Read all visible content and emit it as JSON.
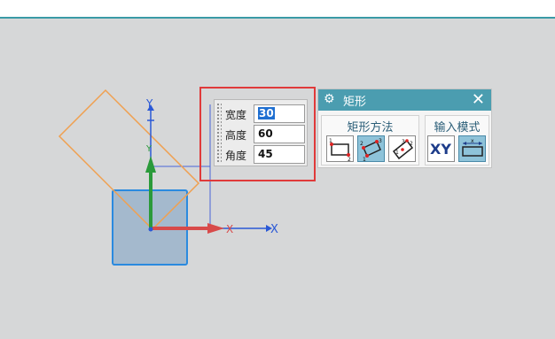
{
  "colors": {
    "background": "#d6d7d8",
    "highlight_box": "#e03a3a",
    "dialog_title_bar": "#4b9db0",
    "rotated_rect": "#f0a050",
    "square_fill": "#9fb6cc",
    "axis_x": "#d84a4a",
    "axis_y": "#2a9a3a",
    "ref_axis": "#2a58d6"
  },
  "scene": {
    "x_axis_label": "X",
    "y_axis_label": "Y",
    "x_axis_label_red": "X",
    "y_axis_label_red": "Y"
  },
  "input_panel": {
    "fields": [
      {
        "label": "宽度",
        "value": "30"
      },
      {
        "label": "高度",
        "value": "60"
      },
      {
        "label": "角度",
        "value": "45"
      }
    ]
  },
  "dialog": {
    "title": "矩形",
    "title_icon": "gear-icon",
    "close_icon": "close-icon",
    "groups": [
      {
        "title": "矩形方法",
        "tools": [
          "two-point-rect-icon",
          "three-point-rect-icon",
          "center-angle-rect-icon"
        ],
        "active_index": 1
      },
      {
        "title": "输入模式",
        "tools": [
          "xy-coordinate-mode",
          "parameter-mode-icon"
        ],
        "active_index": 1
      }
    ],
    "xy_label": "XY"
  }
}
